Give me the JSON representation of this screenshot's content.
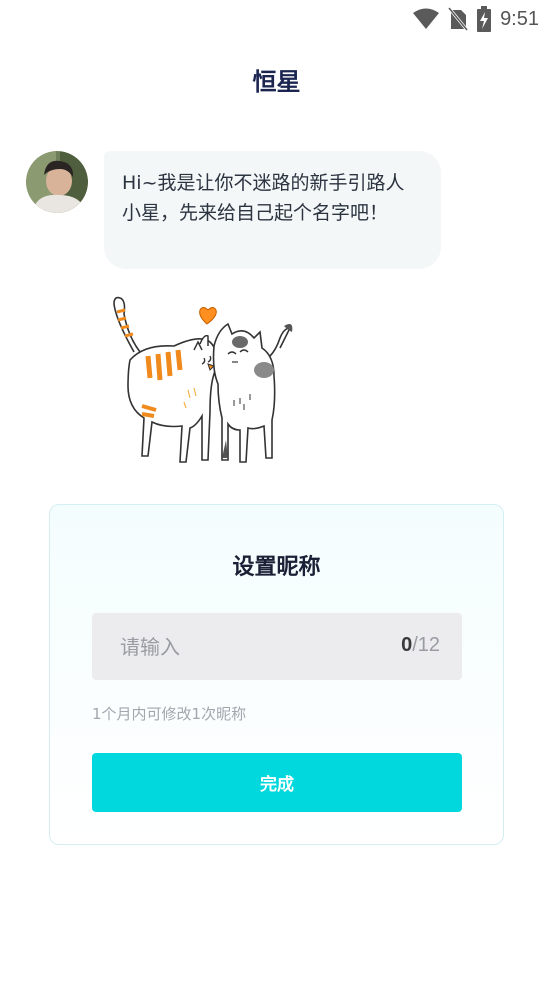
{
  "status_bar": {
    "time": "9:51",
    "icons": [
      "wifi-icon",
      "no-sim-icon",
      "battery-charging-icon"
    ]
  },
  "header": {
    "title": "恒星"
  },
  "chat": {
    "avatar_icon": "user-avatar",
    "message": "Hi~我是让你不迷路的新手引路人小星，先来给自己起个名字吧！"
  },
  "illustration": {
    "name": "two-cats-with-heart"
  },
  "nickname_card": {
    "title": "设置昵称",
    "input_placeholder": "请输入",
    "input_value": "",
    "counter_current": "0",
    "counter_max": "/12",
    "hint": "1个月内可修改1次昵称",
    "done_label": "完成"
  },
  "colors": {
    "accent": "#00d8dd",
    "title": "#1b2550",
    "bubble_bg": "#f3f7f8",
    "input_bg": "#ececee"
  }
}
